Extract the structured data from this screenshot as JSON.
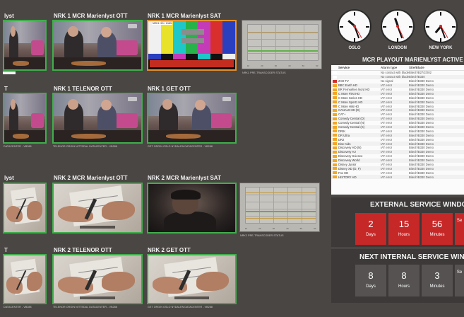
{
  "tiles_row1": [
    {
      "title": "lyst",
      "caption": ""
    },
    {
      "title": "NRK 1 MCR Marienlyst OTT",
      "caption": ""
    },
    {
      "title": "NRK 1 MCR Marienlyst SAT",
      "caption": ""
    }
  ],
  "tiles_row2": [
    {
      "title": "T",
      "caption": "DATACENTER - VB288"
    },
    {
      "title": "NRK 1 TELENOR OTT",
      "caption": "TELENOR ORGIN NITTEDAL DATACENTER - VB288"
    },
    {
      "title": "NRK 1 GET OTT",
      "caption": "GET ORGIN OSLO NYDALEN DATACENTER - VB288"
    }
  ],
  "tiles_row3": [
    {
      "title": "lyst",
      "caption": ""
    },
    {
      "title": "NRK 2 MCR Marienlyst OTT",
      "caption": ""
    },
    {
      "title": "NRK 2 MCR Marienlyst SAT",
      "caption": ""
    }
  ],
  "tiles_row4": [
    {
      "title": "T",
      "caption": "DATACENTER - VB288"
    },
    {
      "title": "NRK 2 TELENOR OTT",
      "caption": "TELENOR ORGIN NITTEDAL DATACENTER - VB288"
    },
    {
      "title": "NRK 2 GET OTT",
      "caption": "GET ORGIN OSLO NYDALEN DATACENTER - VB288"
    }
  ],
  "bars_label": "NRK1 HD / 1080i",
  "graph1_caption": "NRK1 PRE-TRANSCODER STATUS",
  "graph2_caption": "NRK2 PRE-TRANSCODER STATUS",
  "graph_ticks": [
    "10",
    "20",
    "30",
    "40",
    "50",
    "60"
  ],
  "clocks": [
    {
      "city": "OSLO"
    },
    {
      "city": "LONDON"
    },
    {
      "city": "NEW YORK"
    }
  ],
  "alarms": {
    "title": "MCR PLAYOUT MARIENLYST ACTIVE ALA",
    "headers": {
      "service": "Service",
      "type": "Alarm type",
      "site": "Site/Blade"
    },
    "rows": [
      {
        "service": "",
        "type": "No contact with blade",
        "site": "Bitech/B27/2/282",
        "color": "#ffffff"
      },
      {
        "service": "",
        "type": "No contact with blade",
        "site": "Bitech/B330",
        "color": "#ffffff"
      },
      {
        "service": "ZAD TV",
        "type": "No signal",
        "site": "Bitech/B330 Demo",
        "color": "#d32f2f"
      },
      {
        "service": "BBC Earth HD",
        "type": "IAT error",
        "site": "Bitech/B330 Demo",
        "color": "#f5a623"
      },
      {
        "service": "BR Fernsehen Nord HD",
        "type": "IAT error",
        "site": "Bitech/B330 Demo",
        "color": "#f5a623"
      },
      {
        "service": "C More First HD",
        "type": "IAT error",
        "site": "Bitech/B330 Demo",
        "color": "#f5a623"
      },
      {
        "service": "C More Series HD",
        "type": "IAT error",
        "site": "Bitech/B330 Demo",
        "color": "#f5a623"
      },
      {
        "service": "C More Sport1 HD",
        "type": "IAT error",
        "site": "Bitech/B330 Demo",
        "color": "#f5a623"
      },
      {
        "service": "C More Hits HD",
        "type": "IAT error",
        "site": "Bitech/B330 Demo",
        "color": "#f5a623"
      },
      {
        "service": "CANAL9 HD (D)",
        "type": "IAT error",
        "site": "Bitech/B330 Demo",
        "color": "#f5a623"
      },
      {
        "service": "CAT+",
        "type": "IAT error",
        "site": "Bitech/B330 Demo",
        "color": "#f5a623"
      },
      {
        "service": "Comedy Central (D)",
        "type": "IAT error",
        "site": "Bitech/B330 Demo",
        "color": "#f5a623"
      },
      {
        "service": "Comedy Central (N)",
        "type": "IAT error",
        "site": "Bitech/B330 Demo",
        "color": "#f5a623"
      },
      {
        "service": "Comedy Central (S)",
        "type": "IAT error",
        "site": "Bitech/B330 Demo",
        "color": "#f5a623"
      },
      {
        "service": "DRIK",
        "type": "IAT error",
        "site": "Bitech/B330 Demo",
        "color": "#f5a623"
      },
      {
        "service": "DR Ultra",
        "type": "IAT error",
        "site": "Bitech/B330 Demo",
        "color": "#f5a623"
      },
      {
        "service": "DR2",
        "type": "IAT error",
        "site": "Bitech/B330 Demo",
        "color": "#f5a623"
      },
      {
        "service": "Disc Kids",
        "type": "IAT error",
        "site": "Bitech/B330 Demo",
        "color": "#f5a623"
      },
      {
        "service": "Discovery HD (N)",
        "type": "IAT error",
        "site": "Bitech/B330 Demo",
        "color": "#f5a623"
      },
      {
        "service": "Discovery HJ",
        "type": "IAT error",
        "site": "Bitech/B330 Demo",
        "color": "#f5a623"
      },
      {
        "service": "Discovery Science",
        "type": "IAT error",
        "site": "Bitech/B330 Demo",
        "color": "#f5a623"
      },
      {
        "service": "Discovery World",
        "type": "IAT error",
        "site": "Bitech/B330 Demo",
        "color": "#f5a623"
      },
      {
        "service": "Disney Junior",
        "type": "IAT error",
        "site": "Bitech/B330 Demo",
        "color": "#f5a623"
      },
      {
        "service": "Disney XD (D, F)",
        "type": "IAT error",
        "site": "Bitech/B330 Demo",
        "color": "#f5a623"
      },
      {
        "service": "Fox HD",
        "type": "IAT error",
        "site": "Bitech/B330 Demo",
        "color": "#f5a623"
      },
      {
        "service": "HISTORY HD",
        "type": "IAT error",
        "site": "Bitech/B330 Demo",
        "color": "#f5a623"
      }
    ]
  },
  "external_window": {
    "title": "EXTERNAL SERVICE WINDOW",
    "boxes": [
      {
        "num": "2",
        "unit": "Days"
      },
      {
        "num": "15",
        "unit": "Hours"
      },
      {
        "num": "56",
        "unit": "Minutes"
      },
      {
        "num": "",
        "unit": "Se"
      }
    ]
  },
  "internal_window": {
    "title": "NEXT INTERNAL SERVICE WINDO",
    "boxes": [
      {
        "num": "8",
        "unit": "Days"
      },
      {
        "num": "8",
        "unit": "Hours"
      },
      {
        "num": "3",
        "unit": "Minutes"
      },
      {
        "num": "",
        "unit": "Se"
      }
    ]
  }
}
